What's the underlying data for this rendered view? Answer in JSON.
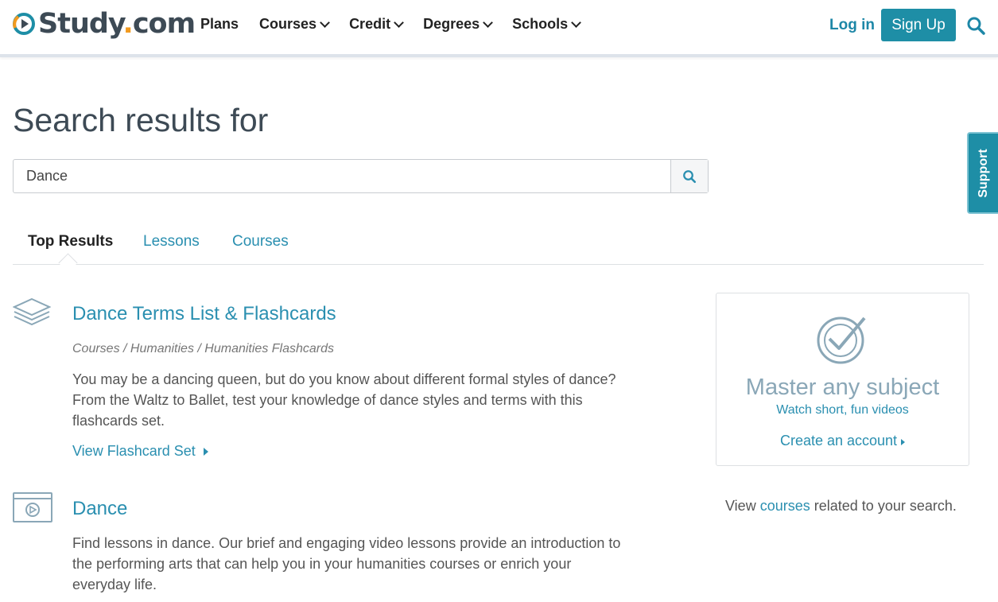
{
  "header": {
    "logo_text": "Study",
    "logo_dot": ".",
    "logo_suffix": "com",
    "nav": [
      {
        "label": "Plans",
        "dropdown": false
      },
      {
        "label": "Courses",
        "dropdown": true
      },
      {
        "label": "Credit",
        "dropdown": true
      },
      {
        "label": "Degrees",
        "dropdown": true
      },
      {
        "label": "Schools",
        "dropdown": true
      }
    ],
    "login_label": "Log in",
    "signup_label": "Sign Up",
    "search_icon": "search-icon"
  },
  "page": {
    "title": "Search results for"
  },
  "search": {
    "value": "Dance",
    "button_icon": "search-icon"
  },
  "tabs": [
    {
      "label": "Top Results",
      "active": true
    },
    {
      "label": "Lessons",
      "active": false
    },
    {
      "label": "Courses",
      "active": false
    }
  ],
  "results": [
    {
      "icon": "flashcard-stack-icon",
      "title": "Dance Terms List & Flashcards",
      "breadcrumb": "Courses / Humanities / Humanities Flashcards",
      "description": "You may be a dancing queen, but do you know about different formal styles of dance? From the Waltz to Ballet, test your knowledge of dance styles and terms with this flashcards set.",
      "link": "View Flashcard Set"
    },
    {
      "icon": "video-lesson-icon",
      "title": "Dance",
      "description": "Find lessons in dance. Our brief and engaging video lessons provide an introduction to the performing arts that can help you in your humanities courses or enrich your everyday life."
    }
  ],
  "sidebar": {
    "card": {
      "icon": "checkmark-badge-icon",
      "title": "Master any subject",
      "subtitle": "Watch short, fun videos",
      "link": "Create an account"
    },
    "view_prefix": "View",
    "view_link": "courses",
    "view_suffix": "related to your search."
  },
  "support_label": "Support",
  "colors": {
    "accent": "#1e8ea6",
    "link": "#2a8fb0",
    "logo_orange": "#f29a1f",
    "heading": "#3d4a55"
  }
}
